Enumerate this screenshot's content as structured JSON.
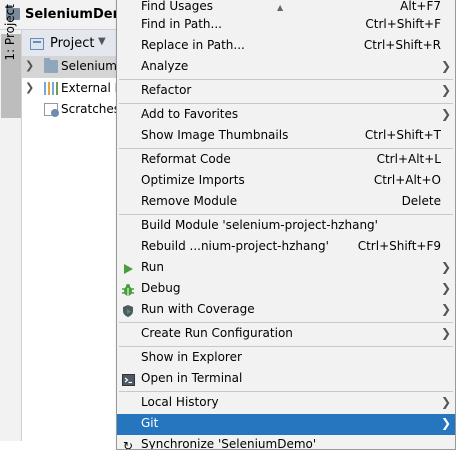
{
  "window": {
    "title": "SeleniumDemo"
  },
  "side_tab": {
    "label": "1: Project"
  },
  "project_panel": {
    "header_label": "Project",
    "tree": [
      {
        "label": "SeleniumDemo",
        "icon": "folder-icon",
        "selected": true
      },
      {
        "label": "External Libraries",
        "icon": "library-icon",
        "selected": false
      },
      {
        "label": "Scratches and Consoles",
        "icon": "scratch-icon",
        "selected": false
      }
    ]
  },
  "menu": {
    "items": {
      "find_usages": {
        "label": "Find Usages",
        "shortcut": "Alt+F7"
      },
      "find_in_path": {
        "label": "Find in Path...",
        "shortcut": "Ctrl+Shift+F"
      },
      "replace_in_path": {
        "label": "Replace in Path...",
        "shortcut": "Ctrl+Shift+R"
      },
      "analyze": {
        "label": "Analyze"
      },
      "refactor": {
        "label": "Refactor"
      },
      "add_to_favorites": {
        "label": "Add to Favorites"
      },
      "show_thumbnails": {
        "label": "Show Image Thumbnails",
        "shortcut": "Ctrl+Shift+T"
      },
      "reformat_code": {
        "label": "Reformat Code",
        "shortcut": "Ctrl+Alt+L"
      },
      "optimize_imports": {
        "label": "Optimize Imports",
        "shortcut": "Ctrl+Alt+O"
      },
      "remove_module": {
        "label": "Remove Module",
        "shortcut": "Delete"
      },
      "build_module": {
        "label": "Build Module 'selenium-project-hzhang'"
      },
      "rebuild": {
        "label": "Rebuild ...nium-project-hzhang'",
        "shortcut": "Ctrl+Shift+F9"
      },
      "run": {
        "label": "Run"
      },
      "debug": {
        "label": "Debug"
      },
      "run_coverage": {
        "label": "Run with Coverage"
      },
      "create_run_config": {
        "label": "Create Run Configuration"
      },
      "show_in_explorer": {
        "label": "Show in Explorer"
      },
      "open_in_terminal": {
        "label": "Open in Terminal"
      },
      "local_history": {
        "label": "Local History"
      },
      "git": {
        "label": "Git",
        "highlighted": true
      },
      "synchronize": {
        "label": "Synchronize 'SeleniumDemo'"
      }
    },
    "colors": {
      "highlight": "#2675bf",
      "run_green": "#4a9e3f",
      "background": "#f2f2f2"
    }
  }
}
